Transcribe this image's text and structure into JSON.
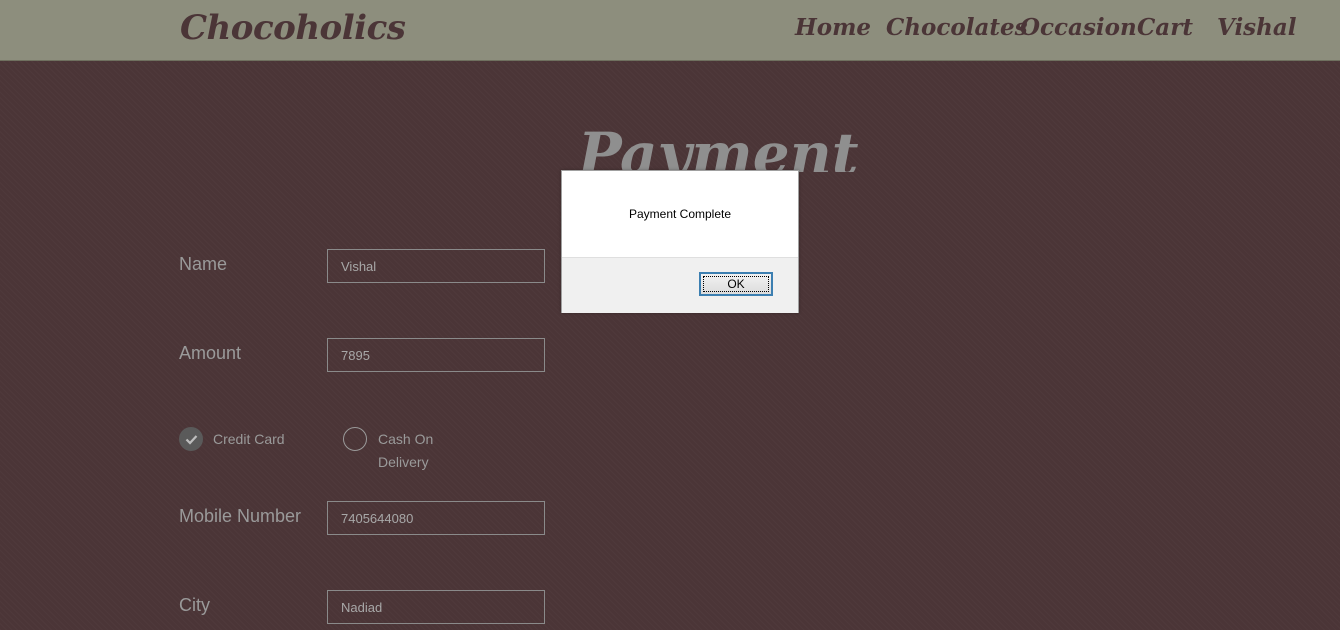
{
  "navbar": {
    "brand": "Chocoholics",
    "items": [
      {
        "label": "Home"
      },
      {
        "label": "Chocolates"
      },
      {
        "label": "Occasion"
      },
      {
        "label": "Cart"
      },
      {
        "label": "Vishal"
      }
    ]
  },
  "page": {
    "title": "Payment"
  },
  "form": {
    "name": {
      "label": "Name",
      "value": "Vishal"
    },
    "amount": {
      "label": "Amount",
      "value": "7895"
    },
    "payment_method": {
      "options": [
        {
          "label": "Credit Card",
          "checked": true
        },
        {
          "label": "Cash On Delivery",
          "checked": false
        }
      ]
    },
    "mobile": {
      "label": "Mobile Number",
      "value": "7405644080"
    },
    "city": {
      "label": "City",
      "value": "Nadiad"
    }
  },
  "dialog": {
    "message": "Payment Complete",
    "ok_label": "OK"
  },
  "colors": {
    "background": "#4b3537",
    "navbar": "#8d8e7d",
    "brand_text": "#4b3537",
    "form_text": "#9a9a9a"
  }
}
